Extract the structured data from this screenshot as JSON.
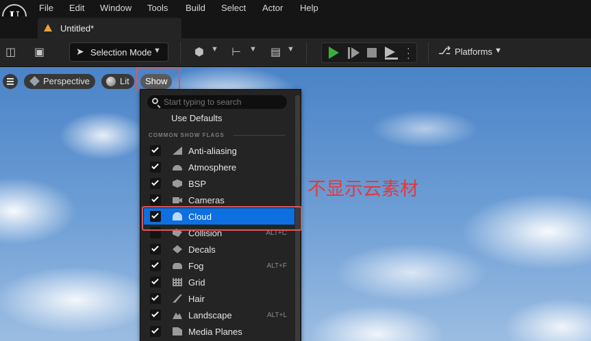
{
  "menubar": {
    "logo": "U",
    "items": [
      {
        "label": "File"
      },
      {
        "label": "Edit"
      },
      {
        "label": "Window"
      },
      {
        "label": "Tools"
      },
      {
        "label": "Build"
      },
      {
        "label": "Select"
      },
      {
        "label": "Actor"
      },
      {
        "label": "Help"
      }
    ]
  },
  "tab": {
    "title": "Untitled*",
    "icon": "level-warning-icon"
  },
  "toolbar": {
    "mode_label": "Selection Mode",
    "platforms_label": "Platforms"
  },
  "viewport": {
    "perspective_label": "Perspective",
    "lit_label": "Lit",
    "show_label": "Show"
  },
  "show_menu": {
    "search_placeholder": "Start typing to search",
    "use_defaults": "Use Defaults",
    "section_header": "COMMON SHOW FLAGS",
    "flags": [
      {
        "label": "Anti-aliasing",
        "checked": true,
        "shortcut": ""
      },
      {
        "label": "Atmosphere",
        "checked": true,
        "shortcut": ""
      },
      {
        "label": "BSP",
        "checked": true,
        "shortcut": ""
      },
      {
        "label": "Cameras",
        "checked": true,
        "shortcut": ""
      },
      {
        "label": "Cloud",
        "checked": true,
        "shortcut": "",
        "selected": true
      },
      {
        "label": "Collision",
        "checked": false,
        "shortcut": "ALT+C"
      },
      {
        "label": "Decals",
        "checked": true,
        "shortcut": ""
      },
      {
        "label": "Fog",
        "checked": true,
        "shortcut": "ALT+F"
      },
      {
        "label": "Grid",
        "checked": true,
        "shortcut": ""
      },
      {
        "label": "Hair",
        "checked": true,
        "shortcut": ""
      },
      {
        "label": "Landscape",
        "checked": true,
        "shortcut": "ALT+L"
      },
      {
        "label": "Media Planes",
        "checked": true,
        "shortcut": ""
      }
    ]
  },
  "annotation": {
    "text": "不显示云素材",
    "color": "#e33a3a"
  },
  "colors": {
    "accent": "#0d6fe0",
    "highlight_box": "#e05757",
    "play": "#3cae3c"
  }
}
